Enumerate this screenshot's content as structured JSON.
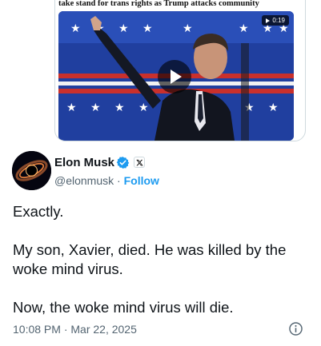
{
  "quoted": {
    "headline": "take stand for trans rights as Trump attacks community",
    "video_duration": "0:19"
  },
  "author": {
    "name": "Elon Musk",
    "handle": "@elonmusk",
    "separator": "·",
    "follow_label": "Follow"
  },
  "tweet": {
    "paragraphs": [
      "Exactly.",
      "My son, Xavier, died. He was killed by the woke mind virus.",
      "Now, the woke mind virus will die."
    ],
    "timestamp": "10:08 PM · Mar 22, 2025"
  },
  "colors": {
    "accent": "#1d9bf0",
    "text": "#0f1419",
    "muted": "#536471",
    "border": "#cfd9de"
  }
}
